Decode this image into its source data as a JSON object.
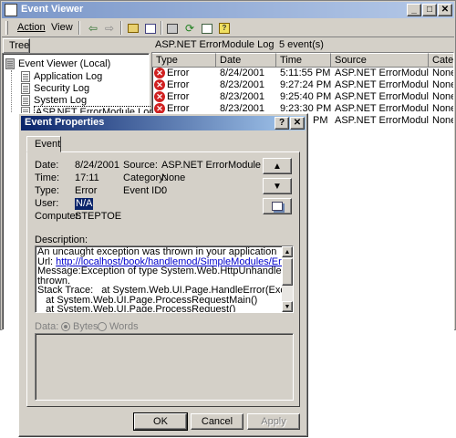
{
  "window": {
    "title": "Event Viewer"
  },
  "menu": {
    "action": "Action",
    "view": "View"
  },
  "tree": {
    "tab": "Tree",
    "root": "Event Viewer (Local)",
    "items": [
      "Application Log",
      "Security Log",
      "System Log",
      "ASP.NET ErrorModule Log"
    ]
  },
  "list": {
    "title": "ASP.NET ErrorModule Log",
    "count": "5 event(s)",
    "columns": [
      "Type",
      "Date",
      "Time",
      "Source",
      "Catego"
    ],
    "rows": [
      {
        "type": "Error",
        "date": "8/24/2001",
        "time": "5:11:55 PM",
        "source": "ASP.NET ErrorModule",
        "category": "None"
      },
      {
        "type": "Error",
        "date": "8/23/2001",
        "time": "9:27:24 PM",
        "source": "ASP.NET ErrorModule",
        "category": "None"
      },
      {
        "type": "Error",
        "date": "8/23/2001",
        "time": "9:25:40 PM",
        "source": "ASP.NET ErrorModule",
        "category": "None"
      },
      {
        "type": "Error",
        "date": "8/23/2001",
        "time": "9:23:30 PM",
        "source": "ASP.NET ErrorModule",
        "category": "None"
      },
      {
        "type": "",
        "date": "",
        "time": "PM",
        "source": "ASP.NET ErrorModule",
        "category": "None"
      }
    ]
  },
  "dialog": {
    "title": "Event Properties",
    "tab": "Event",
    "labels": {
      "date": "Date:",
      "time": "Time:",
      "type": "Type:",
      "user": "User:",
      "computer": "Computer:",
      "source": "Source:",
      "category": "Category:",
      "event_id": "Event ID:",
      "description": "Description:",
      "data": "Data:",
      "bytes": "Bytes",
      "words": "Words"
    },
    "values": {
      "date": "8/24/2001",
      "time": "17:11",
      "type": "Error",
      "user": "N/A",
      "computer": "STEPTOE",
      "source": "ASP.NET ErrorModule",
      "category": "None",
      "event_id": "0"
    },
    "description": {
      "line1": "An uncaught exception was thrown in your application",
      "url_label": "Url: ",
      "url": "http://localhost/book/handlemod/SimpleModules/ErrorPage.aspx",
      "line3": "Message:Exception of type System.Web.HttpUnhandledException was",
      "line4": "thrown.",
      "line5": "Stack Trace:   at System.Web.UI.Page.HandleError(Exception e)",
      "line6": "   at System.Web.UI.Page.ProcessRequestMain()",
      "line7": "   at System.Web.UI.Page.ProcessRequest()"
    },
    "buttons": {
      "ok": "OK",
      "cancel": "Cancel",
      "apply": "Apply"
    }
  }
}
